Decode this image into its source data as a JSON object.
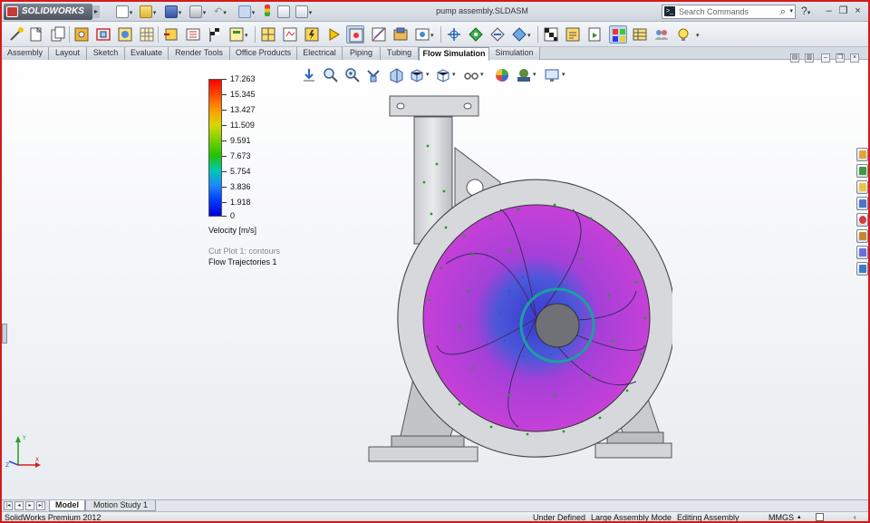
{
  "app": {
    "brand": "SOLIDWORKS",
    "document_title": "pump assembly.SLDASM",
    "search_placeholder": "Search Commands"
  },
  "tabs": [
    {
      "label": "Assembly"
    },
    {
      "label": "Layout"
    },
    {
      "label": "Sketch"
    },
    {
      "label": "Evaluate"
    },
    {
      "label": "Render Tools"
    },
    {
      "label": "Office Products"
    },
    {
      "label": "Electrical"
    },
    {
      "label": "Piping"
    },
    {
      "label": "Tubing"
    },
    {
      "label": "Flow Simulation",
      "active": true
    },
    {
      "label": "Simulation"
    }
  ],
  "legend": {
    "values": [
      "17.263",
      "15.345",
      "13.427",
      "11.509",
      "9.591",
      "7.673",
      "5.754",
      "3.836",
      "1.918",
      "0"
    ],
    "colors": [
      "#ff0000",
      "#ff4a00",
      "#ff9a00",
      "#d8d800",
      "#7ad000",
      "#22c400",
      "#00c8b4",
      "#1a88ff",
      "#0038ff",
      "#0000d8"
    ],
    "unit_label": "Velocity [m/s]",
    "cut_plot_label": "Cut Plot 1: contours",
    "trajectory_label": "Flow Trajectories 1"
  },
  "bottom_tabs": [
    {
      "label": "Model",
      "active": true
    },
    {
      "label": "Motion Study 1"
    }
  ],
  "status": {
    "product": "SolidWorks Premium 2012",
    "definition": "Under Defined",
    "mode": "Large Assembly Mode",
    "editing": "Editing Assembly",
    "units": "MMGS"
  },
  "triad": {
    "x": "X",
    "y": "Y",
    "z": "Z"
  }
}
